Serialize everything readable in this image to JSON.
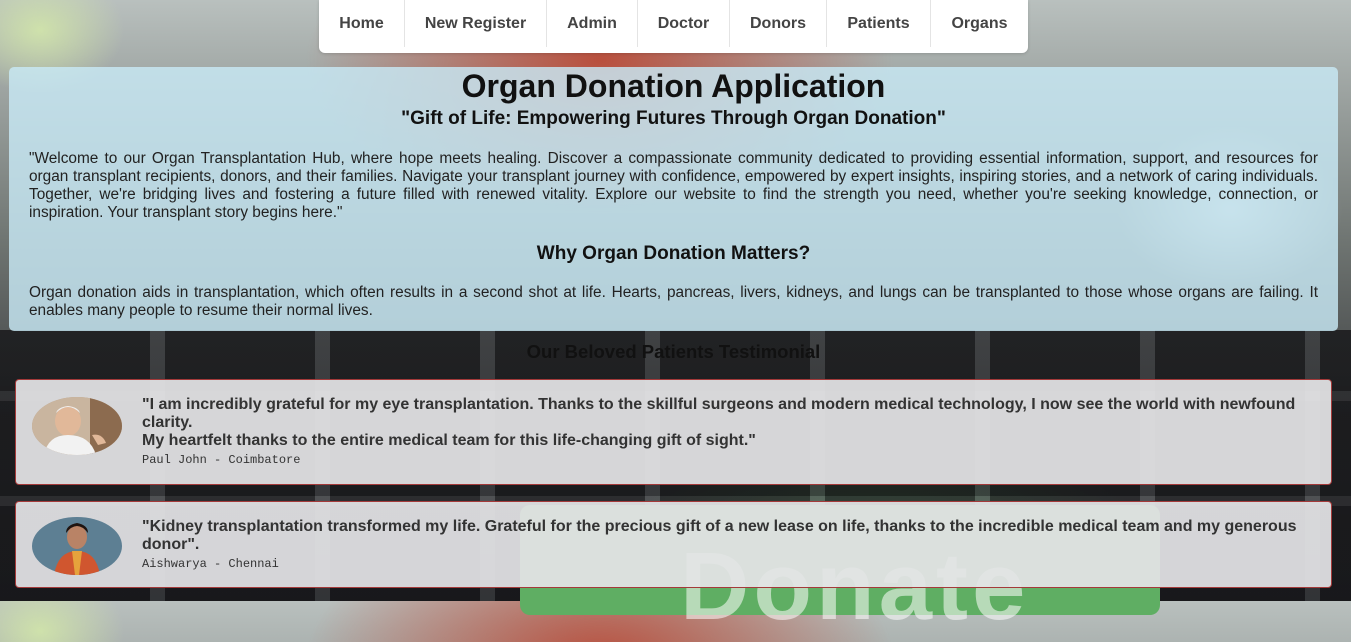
{
  "nav": {
    "items": [
      {
        "label": "Home"
      },
      {
        "label": "New Register"
      },
      {
        "label": "Admin"
      },
      {
        "label": "Doctor"
      },
      {
        "label": "Donors"
      },
      {
        "label": "Patients"
      },
      {
        "label": "Organs"
      }
    ]
  },
  "info": {
    "title": "Organ Donation Application",
    "subtitle": "\"Gift of Life: Empowering Futures Through Organ Donation\"",
    "welcome": "\"Welcome to our Organ Transplantation Hub, where hope meets healing. Discover a compassionate community dedicated to providing essential information, support, and resources for organ transplant recipients, donors, and their families. Navigate your transplant journey with confidence, empowered by expert insights, inspiring stories, and a network of caring individuals. Together, we're bridging lives and fostering a future filled with renewed vitality. Explore our website to find the strength you need, whether you're seeking knowledge, connection, or inspiration. Your transplant story begins here.\"",
    "why_heading": "Why Organ Donation Matters?",
    "why_text": "Organ donation aids in transplantation, which often results in a second shot at life. Hearts, pancreas, livers, kidneys, and lungs can be transplanted to those whose organs are failing. It enables many people to resume their normal lives."
  },
  "testimonials": {
    "heading": "Our Beloved Patients Testimonial",
    "items": [
      {
        "quote_line1": "\"I am incredibly grateful for my eye transplantation. Thanks to the skillful surgeons and modern medical technology, I now see the world with newfound clarity.",
        "quote_line2": "My heartfelt thanks to the entire medical team for this life-changing gift of sight.\"",
        "author": "Paul John - Coimbatore"
      },
      {
        "quote_line1": "\"Kidney transplantation transformed my life. Grateful for the precious gift of a new lease on life, thanks to the incredible medical team and my generous donor\".",
        "author": "Aishwarya - Chennai"
      }
    ]
  },
  "background": {
    "text": "Donate"
  },
  "colors": {
    "panel": "#c8e9f5",
    "card_border": "#a43a3a",
    "card_bg": "#e4e4e6",
    "nav_text": "#444444"
  }
}
